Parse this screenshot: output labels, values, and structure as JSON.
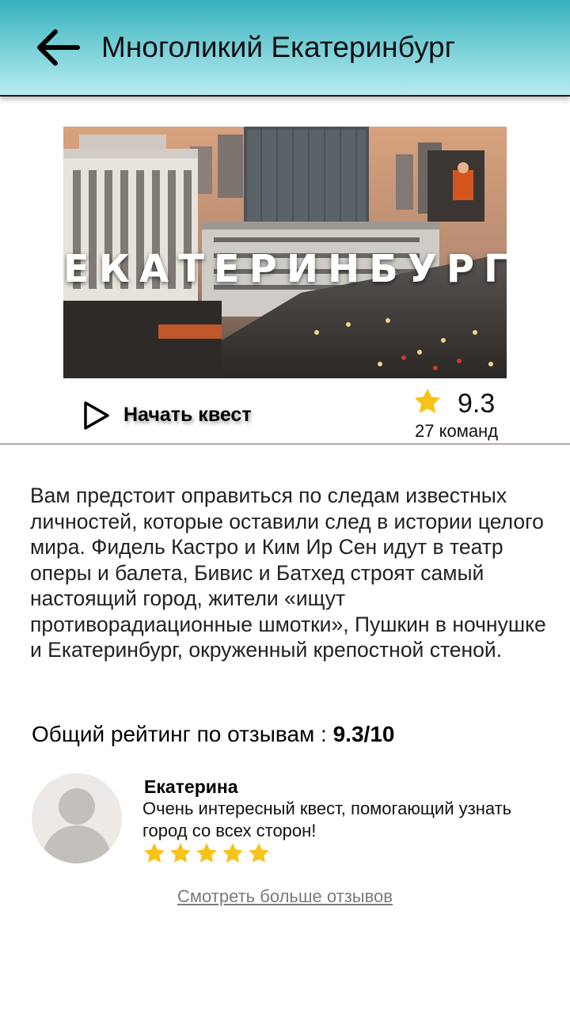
{
  "header": {
    "title": "Многоликий Екатеринбург",
    "back_icon": "arrow-left-icon"
  },
  "hero": {
    "caption": "ЕКАТЕРИНБУРГ",
    "description": "city skyline photo"
  },
  "actions": {
    "start_label": "Начать квест",
    "start_icon": "play-icon"
  },
  "rating": {
    "score": "9.3",
    "teams": "27 команд",
    "icon": "star-icon",
    "star_color": "#f6c319"
  },
  "description": "Вам предстоит оправиться по следам известных личностей, которые оставили след в истории целого мира. Фидель Кастро и Ким Ир Сен идут в театр оперы и балета, Бивис и Батхед строят самый настоящий город, жители «ищут противорадиационные шмотки», Пушкин в ночнушке и Екатеринбург, окруженный крепостной стеной.",
  "overall_rating": {
    "label": "Общий рейтинг по отзывам : ",
    "value": "9.3/10"
  },
  "review": {
    "name": "Екатерина",
    "text": "Очень интересный квест, помогающий узнать город со всех сторон!",
    "stars": 5
  },
  "more_reviews": "Смотреть больше отзывов",
  "colors": {
    "header_gradient_top": "#35b1bd",
    "header_gradient_bottom": "#b7ecf0",
    "divider": "#b9a9ad",
    "link": "#7a7a7a"
  }
}
